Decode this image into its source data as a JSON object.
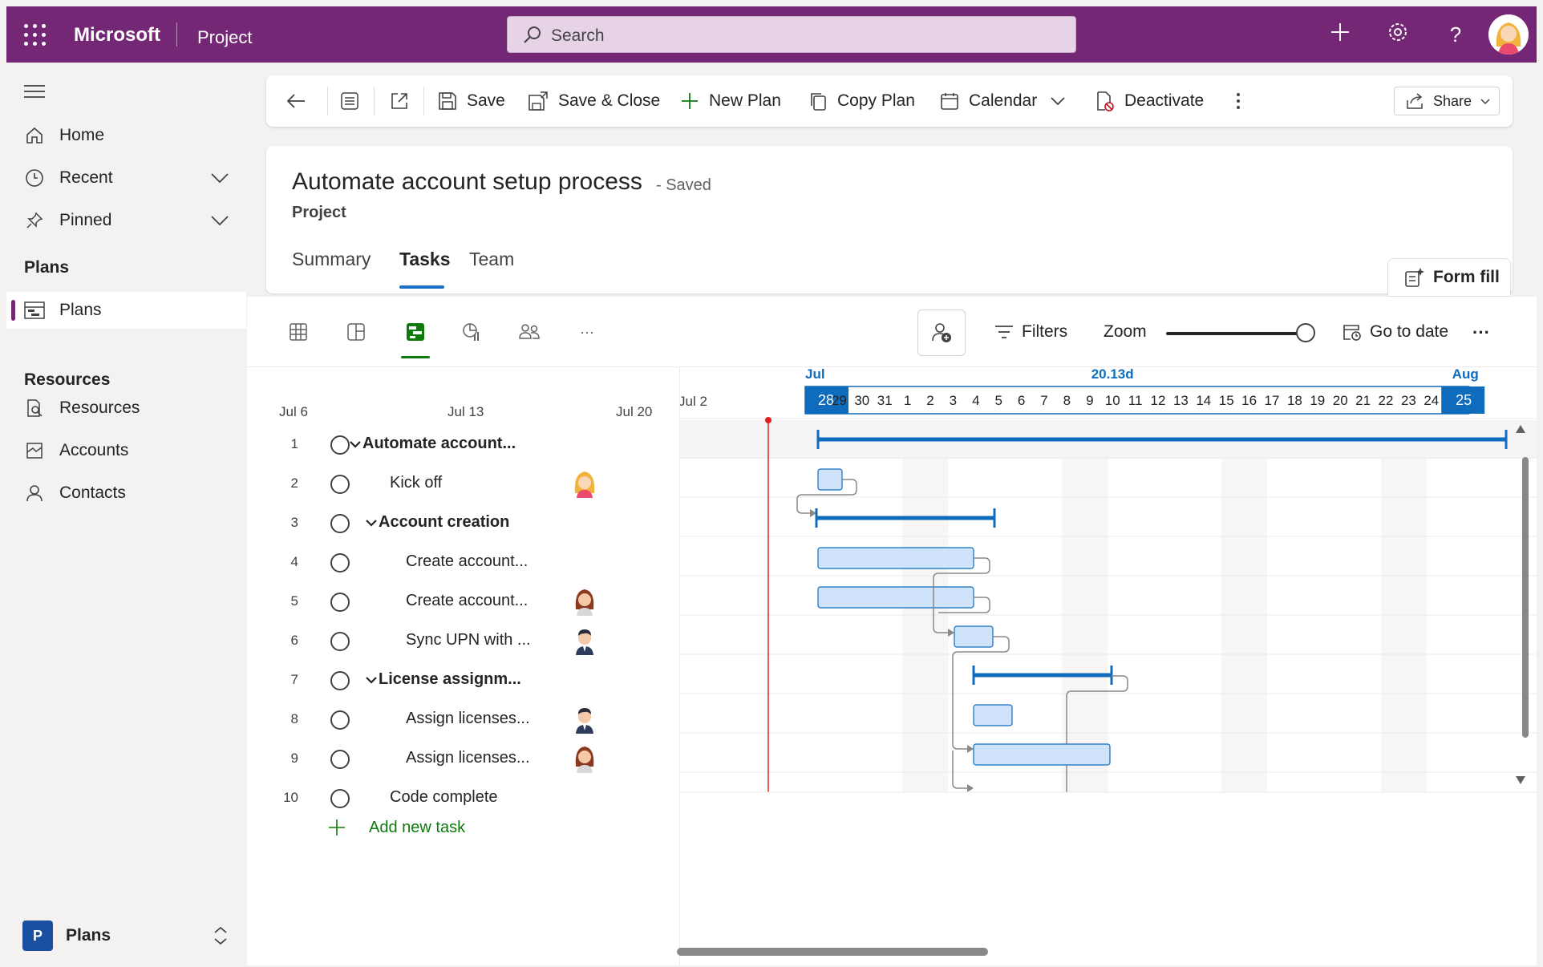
{
  "topbar": {
    "brand": "Microsoft",
    "app": "Project",
    "search_placeholder": "Search"
  },
  "nav": {
    "items": [
      {
        "label": "Home"
      },
      {
        "label": "Recent"
      },
      {
        "label": "Pinned"
      }
    ],
    "plans_heading": "Plans",
    "plans_item": "Plans",
    "resources_heading": "Resources",
    "resources_items": [
      {
        "label": "Resources"
      },
      {
        "label": "Accounts"
      },
      {
        "label": "Contacts"
      }
    ],
    "footer_badge": "P",
    "footer_label": "Plans"
  },
  "cmdbar": {
    "save": "Save",
    "save_close": "Save & Close",
    "new_plan": "New Plan",
    "copy_plan": "Copy Plan",
    "calendar": "Calendar",
    "deactivate": "Deactivate",
    "share": "Share"
  },
  "header": {
    "title": "Automate account setup process",
    "saved": "- Saved",
    "subtitle": "Project",
    "tabs": [
      "Summary",
      "Tasks",
      "Team"
    ],
    "form_fill": "Form fill"
  },
  "viewbar": {
    "filters": "Filters",
    "zoom": "Zoom",
    "zoom_level": 0.9,
    "go_to_date": "Go to date"
  },
  "timeline": {
    "left_dates": [
      "Jul 6",
      "Jul 13",
      "Jul 20",
      "Jul 2"
    ],
    "month_start": "Jul",
    "duration": "20.13d",
    "month_end": "Aug",
    "days": [
      "28",
      "29",
      "30",
      "31",
      "1",
      "2",
      "3",
      "4",
      "5",
      "6",
      "7",
      "8",
      "9",
      "10",
      "11",
      "12",
      "13",
      "14",
      "15",
      "16",
      "17",
      "18",
      "19",
      "20",
      "21",
      "22",
      "23",
      "24",
      "25"
    ]
  },
  "tasks": [
    {
      "num": "1",
      "name": "Automate account...",
      "bold": true,
      "indent": 0,
      "collapse": true,
      "avatar": ""
    },
    {
      "num": "2",
      "name": "Kick off",
      "bold": false,
      "indent": 1,
      "collapse": false,
      "avatar": "blonde"
    },
    {
      "num": "3",
      "name": "Account creation",
      "bold": true,
      "indent": 1,
      "collapse": true,
      "avatar": ""
    },
    {
      "num": "4",
      "name": "Create account...",
      "bold": false,
      "indent": 2,
      "collapse": false,
      "avatar": ""
    },
    {
      "num": "5",
      "name": "Create account...",
      "bold": false,
      "indent": 2,
      "collapse": false,
      "avatar": "brown"
    },
    {
      "num": "6",
      "name": "Sync UPN with ...",
      "bold": false,
      "indent": 2,
      "collapse": false,
      "avatar": "man"
    },
    {
      "num": "7",
      "name": "License assignm...",
      "bold": true,
      "indent": 1,
      "collapse": true,
      "avatar": ""
    },
    {
      "num": "8",
      "name": "Assign licenses...",
      "bold": false,
      "indent": 2,
      "collapse": false,
      "avatar": "man"
    },
    {
      "num": "9",
      "name": "Assign licenses...",
      "bold": false,
      "indent": 2,
      "collapse": false,
      "avatar": "brown"
    },
    {
      "num": "10",
      "name": "Code complete",
      "bold": false,
      "indent": 1,
      "collapse": false,
      "avatar": ""
    }
  ],
  "add_task": "Add new task",
  "colors": {
    "brand": "#742774",
    "accent": "#0f6cbd",
    "bar_fill": "#cfe4fa",
    "today_line": "#e02020"
  }
}
